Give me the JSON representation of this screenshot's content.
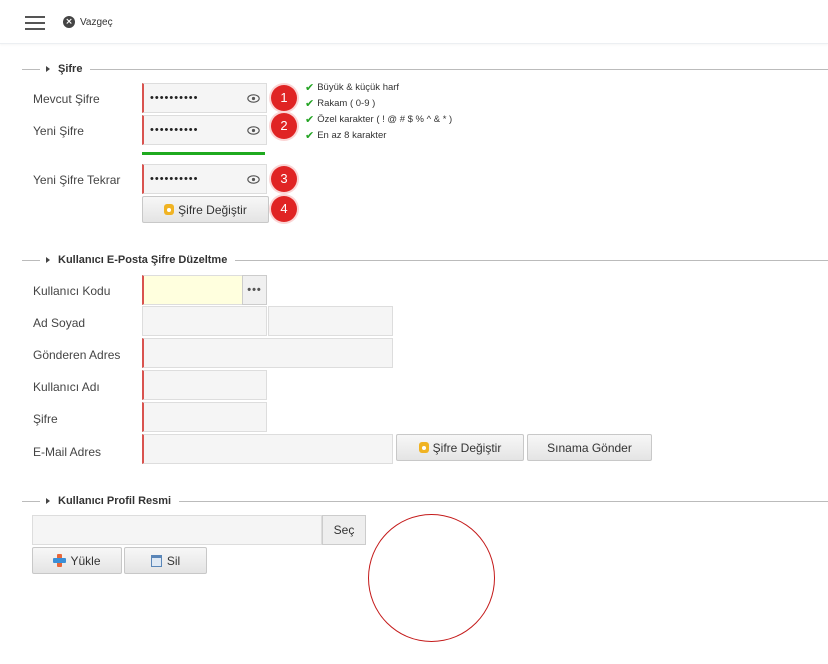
{
  "header": {
    "cancel_label": "Vazgeç"
  },
  "password_section": {
    "title": "Şifre",
    "current_label": "Mevcut Şifre",
    "current_value": "••••••••••",
    "new_label": "Yeni Şifre",
    "new_value": "••••••••••",
    "repeat_label": "Yeni Şifre Tekrar",
    "repeat_value": "••••••••••",
    "change_button": "Şifre Değiştir",
    "badges": [
      "1",
      "2",
      "3",
      "4"
    ],
    "rules": [
      "Büyük & küçük harf",
      "Rakam ( 0-9 )",
      "Özel karakter ( ! @ # $ % ^ & * )",
      "En az 8 karakter"
    ],
    "strength_color": "#1faa1f"
  },
  "email_section": {
    "title": "Kullanıcı E-Posta Şifre Düzeltme",
    "user_code_label": "Kullanıcı Kodu",
    "lookup_button": "•••",
    "name_label": "Ad Soyad",
    "sender_label": "Gönderen Adres",
    "username_label": "Kullanıcı Adı",
    "password_label": "Şifre",
    "email_label": "E-Mail Adres",
    "change_button": "Şifre Değiştir",
    "test_button": "Sınama Gönder"
  },
  "profile_section": {
    "title": "Kullanıcı Profil Resmi",
    "select_button": "Seç",
    "upload_button": "Yükle",
    "delete_button": "Sil"
  },
  "colors": {
    "required_border": "#d9534f",
    "badge": "#e02424",
    "check": "#22a322"
  }
}
